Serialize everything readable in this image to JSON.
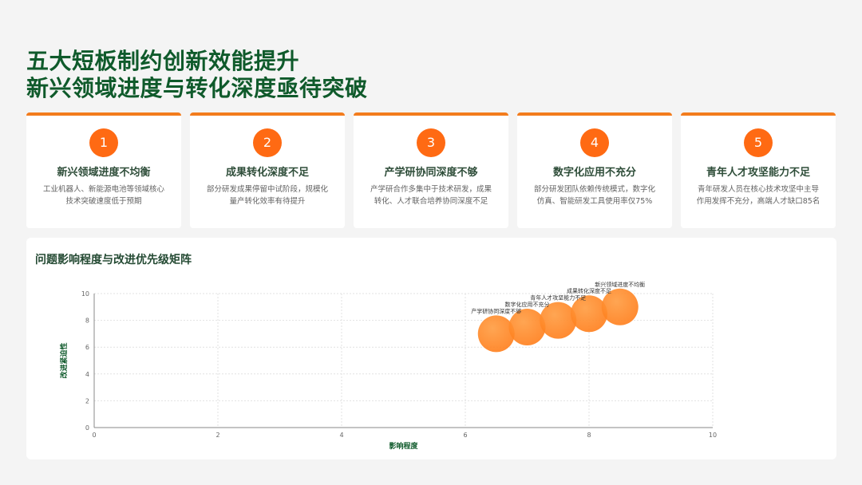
{
  "header": {
    "title_line1": "五大短板制约创新效能提升",
    "title_line2": "新兴领域进度与转化深度亟待突破"
  },
  "cards": [
    {
      "num": "1",
      "title": "新兴领域进度不均衡",
      "desc": "工业机器人、新能源电池等领域核心技术突破速度低于预期"
    },
    {
      "num": "2",
      "title": "成果转化深度不足",
      "desc": "部分研发成果停留中试阶段，规模化量产转化效率有待提升"
    },
    {
      "num": "3",
      "title": "产学研协同深度不够",
      "desc": "产学研合作多集中于技术研发，成果转化、人才联合培养协同深度不足"
    },
    {
      "num": "4",
      "title": "数字化应用不充分",
      "desc": "部分研发团队依赖传统模式，数字化仿真、智能研发工具使用率仅75%"
    },
    {
      "num": "5",
      "title": "青年人才攻坚能力不足",
      "desc": "青年研发人员在核心技术攻坚中主导作用发挥不充分，高端人才缺口85名"
    }
  ],
  "chart_panel": {
    "title": "问题影响程度与改进优先级矩阵"
  },
  "chart_data": {
    "type": "scatter",
    "title": "问题影响程度与改进优先级矩阵",
    "xlabel": "影响程度",
    "ylabel": "改进紧迫性",
    "xlim": [
      0,
      10
    ],
    "ylim": [
      0,
      10
    ],
    "xticks": [
      0,
      2,
      4,
      6,
      8,
      10
    ],
    "yticks": [
      0,
      2,
      4,
      6,
      8,
      10
    ],
    "grid": true,
    "marker_color": "#ff7a14",
    "points": [
      {
        "label": "产学研协同深度不够",
        "x": 6.5,
        "y": 7.0
      },
      {
        "label": "数字化应用不充分",
        "x": 7.0,
        "y": 7.5
      },
      {
        "label": "青年人才攻坚能力不足",
        "x": 7.5,
        "y": 8.0
      },
      {
        "label": "成果转化深度不足",
        "x": 8.0,
        "y": 8.5
      },
      {
        "label": "新兴领域进度不均衡",
        "x": 8.5,
        "y": 9.0
      }
    ]
  },
  "colors": {
    "accent": "#f37c1d",
    "title": "#0f5a2b",
    "badge": "#ff6a13"
  }
}
